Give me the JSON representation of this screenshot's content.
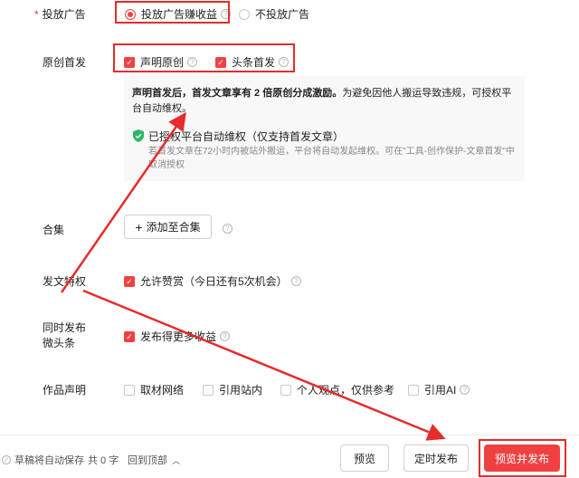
{
  "ads": {
    "label": "投放广告",
    "required_mark": "*",
    "option_on": "投放广告赚收益",
    "option_off": "不投放广告"
  },
  "original": {
    "label": "原创首发",
    "option_original": "声明原创",
    "option_first": "头条首发",
    "info_bold_1": "声明首发后，首发文章享有 2 倍原创分成激励。",
    "info_rest": "为避免因他人搬运导致违规，可授权平台自动维权。",
    "authorized_title": "已授权平台自动维权（仅支持首发文章）",
    "authorized_desc": "若首发文章在72小时内被站外搬运，平台将自动发起维权。可在\"工具-创作保护-文章首发\"中取消授权"
  },
  "collection": {
    "label": "合集",
    "add_button": "添加至合集"
  },
  "privilege": {
    "label": "发文特权",
    "option": "允许赞赏（今日还有5次机会）"
  },
  "weitoutiao": {
    "label_line1": "同时发布",
    "label_line2": "微头条",
    "option": "发布得更多收益"
  },
  "declaration": {
    "label": "作品声明",
    "options": [
      "取材网络",
      "引用站内",
      "个人观点，仅供参考",
      "引用AI"
    ]
  },
  "footer": {
    "autosave": "草稿将自动保存",
    "word_count": "共 0 字",
    "back_to_top": "回到顶部",
    "preview": "预览",
    "scheduled": "定时发布",
    "publish": "预览并发布"
  },
  "colors": {
    "accent": "#f04142",
    "annotation": "#e62c2c",
    "shield": "#2fb56a"
  }
}
